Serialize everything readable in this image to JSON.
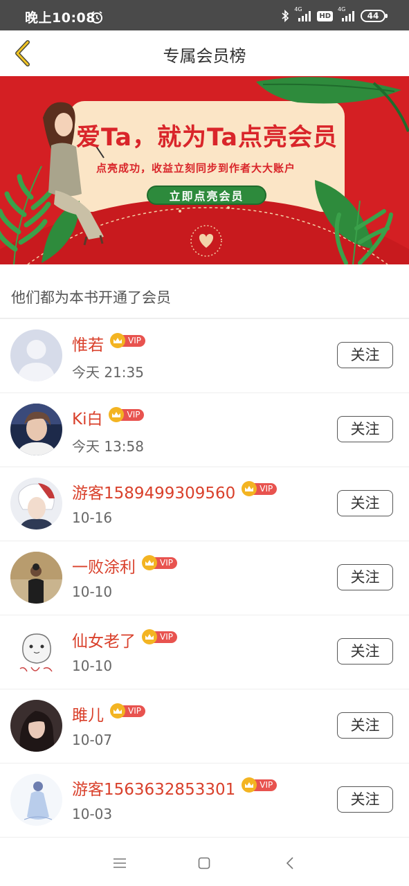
{
  "status_bar": {
    "time": "晚上10:08",
    "network_left": "4G",
    "hd": "HD",
    "network_right": "4G",
    "battery": "44",
    "icons": [
      "alarm-icon",
      "bluetooth-icon",
      "signal-icon",
      "hd-icon",
      "signal-icon",
      "battery-icon"
    ]
  },
  "header": {
    "title": "专属会员榜",
    "back_icon": "chevron-left-icon",
    "accent_color": "#f3b422"
  },
  "banner": {
    "title": "爱Ta，就为Ta点亮会员",
    "subtitle": "点亮成功，收益立刻同步到作者大大账户",
    "cta_label": "立即点亮会员",
    "background_color": "#d41f23",
    "card_color": "#fbe5c6"
  },
  "section": {
    "title": "他们都为本书开通了会员"
  },
  "members": [
    {
      "name": "惟若",
      "badge": "VIP",
      "date": "今天 21:35",
      "follow_label": "关注",
      "avatar": "default-avatar"
    },
    {
      "name": "Ki白",
      "badge": "VIP",
      "date": "今天 13:58",
      "follow_label": "关注",
      "avatar": "photo-avatar"
    },
    {
      "name": "游客1589499309560",
      "badge": "VIP",
      "date": "10-16",
      "follow_label": "关注",
      "avatar": "anime-avatar"
    },
    {
      "name": "一败涂利",
      "badge": "VIP",
      "date": "10-10",
      "follow_label": "关注",
      "avatar": "photo-avatar"
    },
    {
      "name": "仙女老了",
      "badge": "VIP",
      "date": "10-10",
      "follow_label": "关注",
      "avatar": "drawing-avatar"
    },
    {
      "name": "雎儿",
      "badge": "VIP",
      "date": "10-07",
      "follow_label": "关注",
      "avatar": "photo-avatar"
    },
    {
      "name": "游客1563632853301",
      "badge": "VIP",
      "date": "10-03",
      "follow_label": "关注",
      "avatar": "illustration-avatar"
    }
  ],
  "colors": {
    "name": "#d9402b",
    "vip_crown": "#f3b422",
    "vip_tag": "#e8534f",
    "status_bar": "#4a4a4a"
  },
  "nav_bar": {
    "icons": [
      "menu-icon",
      "home-icon",
      "back-icon"
    ]
  }
}
